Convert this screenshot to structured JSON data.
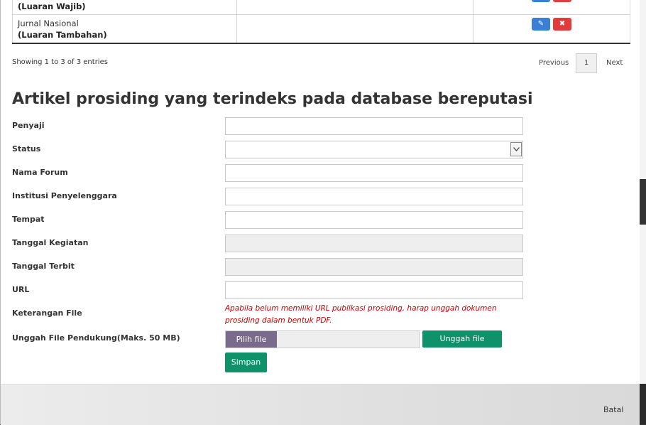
{
  "table": {
    "rows": [
      {
        "name_line1": "",
        "name_line2": "(Luaran Wajib)",
        "col2": ""
      },
      {
        "name_line1": "Jurnal Nasional",
        "name_line2": "(Luaran Tambahan)",
        "col2": ""
      }
    ]
  },
  "table_info": "Showing 1 to 3 of 3 entries",
  "pagination": {
    "previous": "Previous",
    "page": "1",
    "next": "Next"
  },
  "section": {
    "title": "Artikel prosiding yang terindeks pada database bereputasi"
  },
  "form": {
    "penyaji_label": "Penyaji",
    "status_label": "Status",
    "nama_forum_label": "Nama Forum",
    "institusi_label": "Institusi Penyelenggara",
    "tempat_label": "Tempat",
    "tanggal_kegiatan_label": "Tanggal Kegiatan",
    "tanggal_terbit_label": "Tanggal Terbit",
    "url_label": "URL",
    "keterangan_label": "Keterangan File",
    "keterangan_note": "Apabila belum memiliki URL publikasi prosiding, harap unggah dokumen prosiding dalam bentuk PDF.",
    "unggah_label": "Unggah File Pendukung(Maks. 50 MB)",
    "pilih_file": "Pilih file",
    "unggah_button": "Unggah file",
    "simpan_button": "Simpan"
  },
  "footer": {
    "batal": "Batal"
  },
  "colors": {
    "edit": "#3b7fd4",
    "delete": "#e23b3b",
    "green": "#0f9269",
    "file_button": "#7a6a8c",
    "note": "#cc0000"
  }
}
